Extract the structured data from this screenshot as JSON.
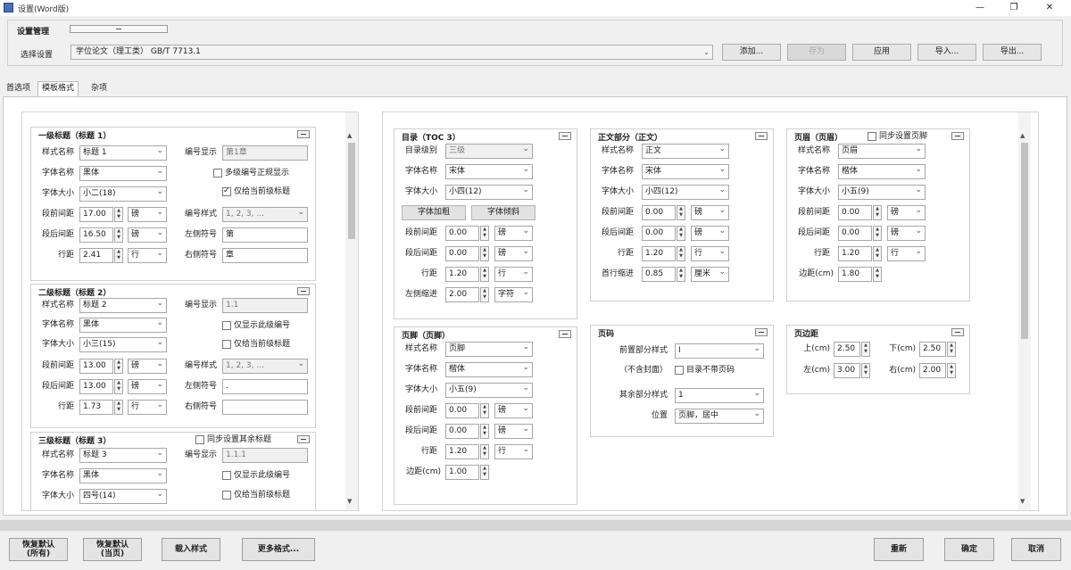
{
  "window": {
    "title": "设置(Word版)",
    "minimize": "—",
    "restore": "❐",
    "close": "✕"
  },
  "management": {
    "title": "设置管理",
    "preset_label": "选择设置",
    "preset_value": "学位论文（理工类） GB/T 7713.1",
    "buttons": {
      "add": "添加...",
      "save": "存为",
      "apply": "应用",
      "import": "导入...",
      "export": "导出..."
    }
  },
  "tabs": [
    "首选项",
    "模板格式",
    "杂项"
  ],
  "left": {
    "h1": {
      "title": "一级标题（标题 1）",
      "style_name_label": "样式名称",
      "style_name": "标题 1",
      "font_name_label": "字体名称",
      "font_name": "黑体",
      "font_size_label": "字体大小",
      "font_size": "小二(18)",
      "space_before_label": "段前间距",
      "space_before": "17.00",
      "space_before_unit": "磅",
      "space_after_label": "段后间距",
      "space_after": "16.50",
      "space_after_unit": "磅",
      "line_spacing_label": "行距",
      "line_spacing": "2.41",
      "line_spacing_unit": "行",
      "number_display_label": "编号显示",
      "number_display": "第1章",
      "multi_level_label": "多级编号正规显示",
      "multi_level_checked": false,
      "only_this_level_label": "仅给当前级标题",
      "only_this_level_checked": true,
      "number_style_label": "编号样式",
      "number_style": "1, 2, 3, ...",
      "left_symbol_label": "左侧符号",
      "left_symbol": "第",
      "right_symbol_label": "右侧符号",
      "right_symbol": "章"
    },
    "h2": {
      "title": "二级标题（标题 2）",
      "style_name_label": "样式名称",
      "style_name": "标题 2",
      "font_name_label": "字体名称",
      "font_name": "黑体",
      "font_size_label": "字体大小",
      "font_size": "小三(15)",
      "space_before_label": "段前间距",
      "space_before": "13.00",
      "space_before_unit": "磅",
      "space_after_label": "段后间距",
      "space_after": "13.00",
      "space_after_unit": "磅",
      "line_spacing_label": "行距",
      "line_spacing": "1.73",
      "line_spacing_unit": "行",
      "number_display_label": "编号显示",
      "number_display": "1.1",
      "show_this_level_label": "仅显示此级编号",
      "show_this_level_checked": false,
      "only_this_level_label": "仅给当前级标题",
      "only_this_level_checked": false,
      "number_style_label": "编号样式",
      "number_style": "1, 2, 3, ...",
      "left_symbol_label": "左侧符号",
      "left_symbol": ".",
      "right_symbol_label": "右侧符号",
      "right_symbol": ""
    },
    "h3": {
      "title": "三级标题（标题 3）",
      "sync_label": "同步设置其余标题",
      "sync_checked": false,
      "style_name_label": "样式名称",
      "style_name": "标题 3",
      "font_name_label": "字体名称",
      "font_name": "黑体",
      "font_size_label": "字体大小",
      "font_size": "四号(14)",
      "number_display_label": "编号显示",
      "number_display": "1.1.1",
      "show_this_level_label": "仅显示此级编号",
      "show_this_level_checked": false,
      "only_this_level_label": "仅给当前级标题",
      "only_this_level_checked": false
    }
  },
  "right": {
    "toc": {
      "title": "目录（TOC 3）",
      "level_label": "目录级别",
      "level": "三级",
      "font_name_label": "字体名称",
      "font_name": "宋体",
      "font_size_label": "字体大小",
      "font_size": "小四(12)",
      "bold_button": "字体加粗",
      "italic_button": "字体倾斜",
      "space_before_label": "段前间距",
      "space_before": "0.00",
      "space_before_unit": "磅",
      "space_after_label": "段后间距",
      "space_after": "0.00",
      "space_after_unit": "磅",
      "line_spacing_label": "行距",
      "line_spacing": "1.20",
      "line_spacing_unit": "行",
      "indent_label": "左侧缩进",
      "indent": "2.00",
      "indent_unit": "字符"
    },
    "body": {
      "title": "正文部分（正文）",
      "style_name_label": "样式名称",
      "style_name": "正文",
      "font_name_label": "字体名称",
      "font_name": "宋体",
      "font_size_label": "字体大小",
      "font_size": "小四(12)",
      "space_before_label": "段前间距",
      "space_before": "0.00",
      "space_before_unit": "磅",
      "space_after_label": "段后间距",
      "space_after": "0.00",
      "space_after_unit": "磅",
      "line_spacing_label": "行距",
      "line_spacing": "1.20",
      "line_spacing_unit": "行",
      "first_indent_label": "首行缩进",
      "first_indent": "0.85",
      "first_indent_unit": "厘米"
    },
    "header": {
      "title": "页眉（页眉）",
      "sync_label": "同步设置页脚",
      "sync_checked": false,
      "style_name_label": "样式名称",
      "style_name": "页眉",
      "font_name_label": "字体名称",
      "font_name": "楷体",
      "font_size_label": "字体大小",
      "font_size": "小五(9)",
      "space_before_label": "段前间距",
      "space_before": "0.00",
      "space_before_unit": "磅",
      "space_after_label": "段后间距",
      "space_after": "0.00",
      "space_after_unit": "磅",
      "line_spacing_label": "行距",
      "line_spacing": "1.20",
      "line_spacing_unit": "行",
      "margin_label": "边距(cm)",
      "margin": "1.80"
    },
    "footer": {
      "title": "页脚（页脚）",
      "style_name_label": "样式名称",
      "style_name": "页脚",
      "font_name_label": "字体名称",
      "font_name": "楷体",
      "font_size_label": "字体大小",
      "font_size": "小五(9)",
      "space_before_label": "段前间距",
      "space_before": "0.00",
      "space_before_unit": "磅",
      "space_after_label": "段后间距",
      "space_after": "0.00",
      "space_after_unit": "磅",
      "line_spacing_label": "行距",
      "line_spacing": "1.20",
      "line_spacing_unit": "行",
      "margin_label": "边距(cm)",
      "margin": "1.00"
    },
    "pagenum": {
      "title": "页码",
      "front_style_label": "前置部分样式",
      "front_style": "I",
      "no_cover_label": "（不含封面）",
      "no_toc_label": "目录不带页码",
      "no_toc_checked": false,
      "rest_style_label": "其余部分样式",
      "rest_style": "1",
      "position_label": "位置",
      "position": "页脚，居中"
    },
    "margins": {
      "title": "页边距",
      "top_label": "上(cm)",
      "top": "2.50",
      "bottom_label": "下(cm)",
      "bottom": "2.50",
      "left_label": "左(cm)",
      "left": "3.00",
      "right_label": "右(cm)",
      "right": "2.00"
    }
  },
  "bottom": {
    "restore_all": "恢复默认\n(所有)",
    "restore_current": "恢复默认\n(当页)",
    "load_style": "载入样式",
    "more_formats": "更多格式...",
    "reset": "重新",
    "ok": "确定",
    "cancel": "取消"
  }
}
